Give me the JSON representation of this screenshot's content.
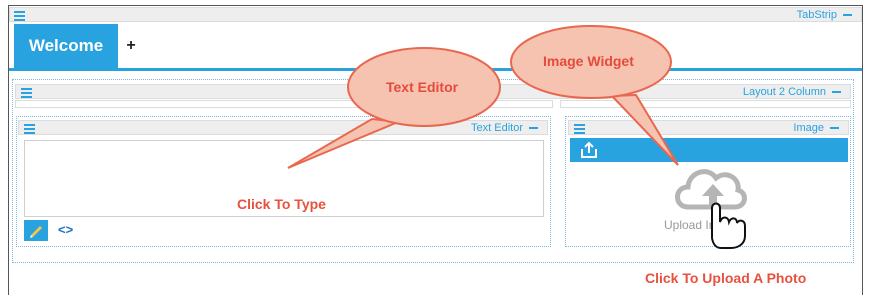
{
  "tabstrip": {
    "title": "TabStrip",
    "tabs": [
      {
        "label": "Welcome"
      },
      {
        "label": "+"
      }
    ]
  },
  "layout": {
    "title": "Layout 2 Column"
  },
  "text_editor": {
    "title": "Text Editor",
    "placeholder_hint": "Click To Type",
    "tools": [
      {
        "icon": "pencil-icon"
      },
      {
        "icon": "code-icon",
        "label": "<>"
      }
    ]
  },
  "image_widget": {
    "title": "Image",
    "upload_text": "Upload Image",
    "hint": "Click To Upload A Photo"
  },
  "callouts": {
    "text_editor": "Text Editor",
    "image_widget": "Image Widget"
  },
  "colors": {
    "accent": "#29a3e0",
    "callout_red": "#e44b3c",
    "callout_fill": "#f7c7b7"
  }
}
